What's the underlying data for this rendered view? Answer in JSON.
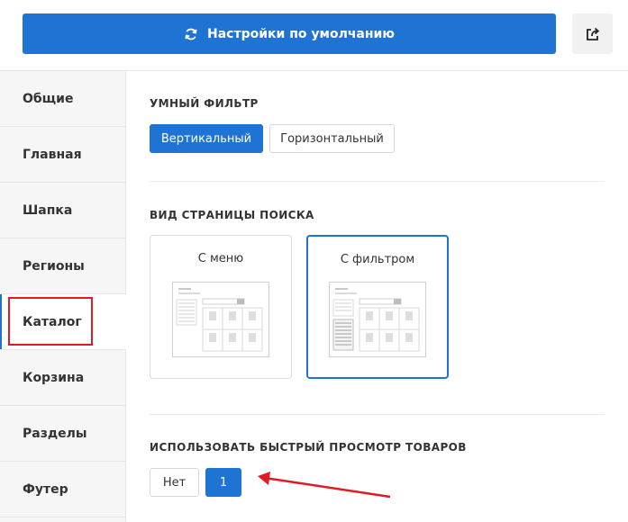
{
  "header": {
    "reset_label": "Настройки по умолчанию"
  },
  "sidebar": {
    "items": [
      {
        "label": "Общие"
      },
      {
        "label": "Главная"
      },
      {
        "label": "Шапка"
      },
      {
        "label": "Регионы"
      },
      {
        "label": "Каталог"
      },
      {
        "label": "Корзина"
      },
      {
        "label": "Разделы"
      },
      {
        "label": "Футер"
      }
    ],
    "active_index": 4
  },
  "smart_filter": {
    "title": "УМНЫЙ ФИЛЬТР",
    "options": [
      "Вертикальный",
      "Горизонтальный"
    ],
    "selected": "Вертикальный"
  },
  "search_page": {
    "title": "ВИД СТРАНИЦЫ ПОИСКА",
    "options": [
      "С меню",
      "С фильтром"
    ],
    "selected": "С фильтром"
  },
  "quick_view": {
    "title": "ИСПОЛЬЗОВАТЬ БЫСТРЫЙ ПРОСМОТР ТОВАРОВ",
    "options": [
      "Нет",
      "1"
    ],
    "selected": "1"
  },
  "colors": {
    "accent": "#1f74d3",
    "annotation": "#e11b22"
  }
}
